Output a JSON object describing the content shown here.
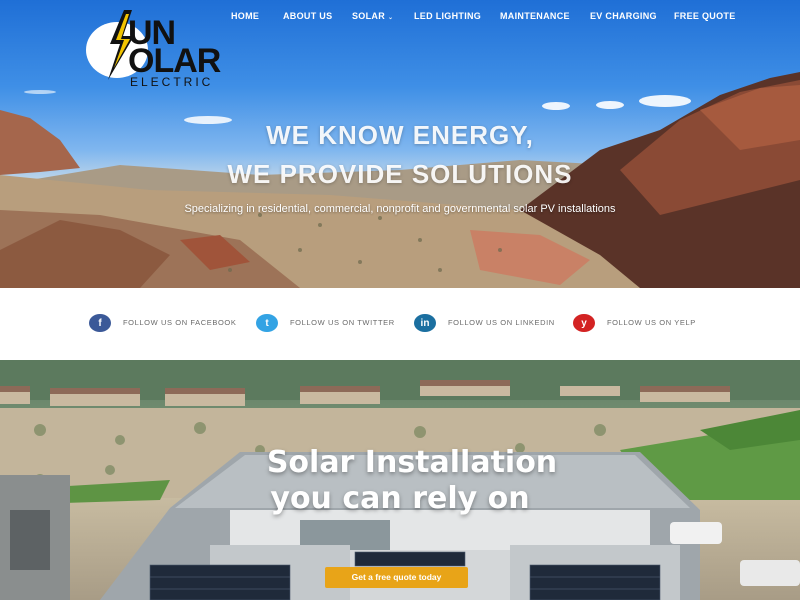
{
  "brand": {
    "line1": "UN",
    "line2": "OLAR",
    "line3": "ELECTRIC",
    "mark": "S"
  },
  "nav": [
    {
      "label": "HOME"
    },
    {
      "label": "ABOUT US"
    },
    {
      "label": "SOLAR",
      "caret": "⌄"
    },
    {
      "label": "LED LIGHTING"
    },
    {
      "label": "MAINTENANCE"
    },
    {
      "label": "EV CHARGING"
    },
    {
      "label": "FREE QUOTE"
    }
  ],
  "hero": {
    "title_line1": "WE KNOW ENERGY,",
    "title_line2": "WE PROVIDE SOLUTIONS",
    "subtitle": "Specializing in residential, commercial, nonprofit and governmental solar PV installations"
  },
  "social": [
    {
      "icon": "facebook-icon",
      "glyph": "f",
      "color": "#3b5998",
      "label": "FOLLOW US ON FACEBOOK"
    },
    {
      "icon": "twitter-icon",
      "glyph": "t",
      "color": "#33a3e4",
      "label": "FOLLOW US ON TWITTER"
    },
    {
      "icon": "linkedin-icon",
      "glyph": "in",
      "color": "#1b6fa0",
      "label": "FOLLOW US ON LINKEDIN"
    },
    {
      "icon": "yelp-icon",
      "glyph": "y",
      "color": "#d32323",
      "label": "FOLLOW US ON YELP"
    }
  ],
  "install": {
    "title_line1": "Solar Installation",
    "title_line2": "you can rely on",
    "cta_label": "Get a free quote today"
  },
  "colors": {
    "accent": "#e8a418",
    "sky": "#3f8fe6"
  }
}
